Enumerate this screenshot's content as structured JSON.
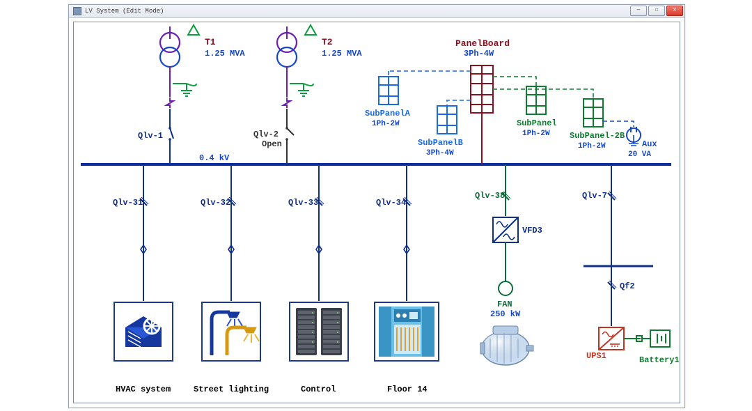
{
  "window": {
    "title": "LV System (Edit Mode)"
  },
  "bus": {
    "voltage_label": "0.4 kV"
  },
  "transformers": [
    {
      "name": "T1",
      "rating": "1.25 MVA"
    },
    {
      "name": "T2",
      "rating": "1.25 MVA"
    }
  ],
  "incomers": [
    {
      "name": "Qlv-1",
      "state": "Closed"
    },
    {
      "name": "Qlv-2",
      "state": "Open"
    }
  ],
  "feeders": [
    {
      "breaker": "Qlv-31",
      "load_label": "HVAC system"
    },
    {
      "breaker": "Qlv-32",
      "load_label": "Street lighting"
    },
    {
      "breaker": "Qlv-33",
      "load_label": "Control"
    },
    {
      "breaker": "Qlv-34",
      "load_label": "Floor 14"
    },
    {
      "breaker": "Qlv-38",
      "vfd": "VFD3",
      "motor_label": "FAN",
      "motor_rating": "250 kW"
    },
    {
      "breaker": "Qlv-7",
      "sub_breaker": "Qf2",
      "ups": "UPS1",
      "battery": "Battery1"
    }
  ],
  "panels": {
    "main": {
      "name": "PanelBoard",
      "config": "3Ph-4W"
    },
    "subA": {
      "name": "SubPanelA",
      "config": "1Ph-2W"
    },
    "subB": {
      "name": "SubPanelB",
      "config": "3Ph-4W"
    },
    "sub1": {
      "name": "SubPanel",
      "config": "1Ph-2W"
    },
    "sub2B": {
      "name": "SubPanel-2B",
      "config": "1Ph-2W"
    },
    "aux": {
      "name": "Aux",
      "rating": "20 VA"
    }
  }
}
